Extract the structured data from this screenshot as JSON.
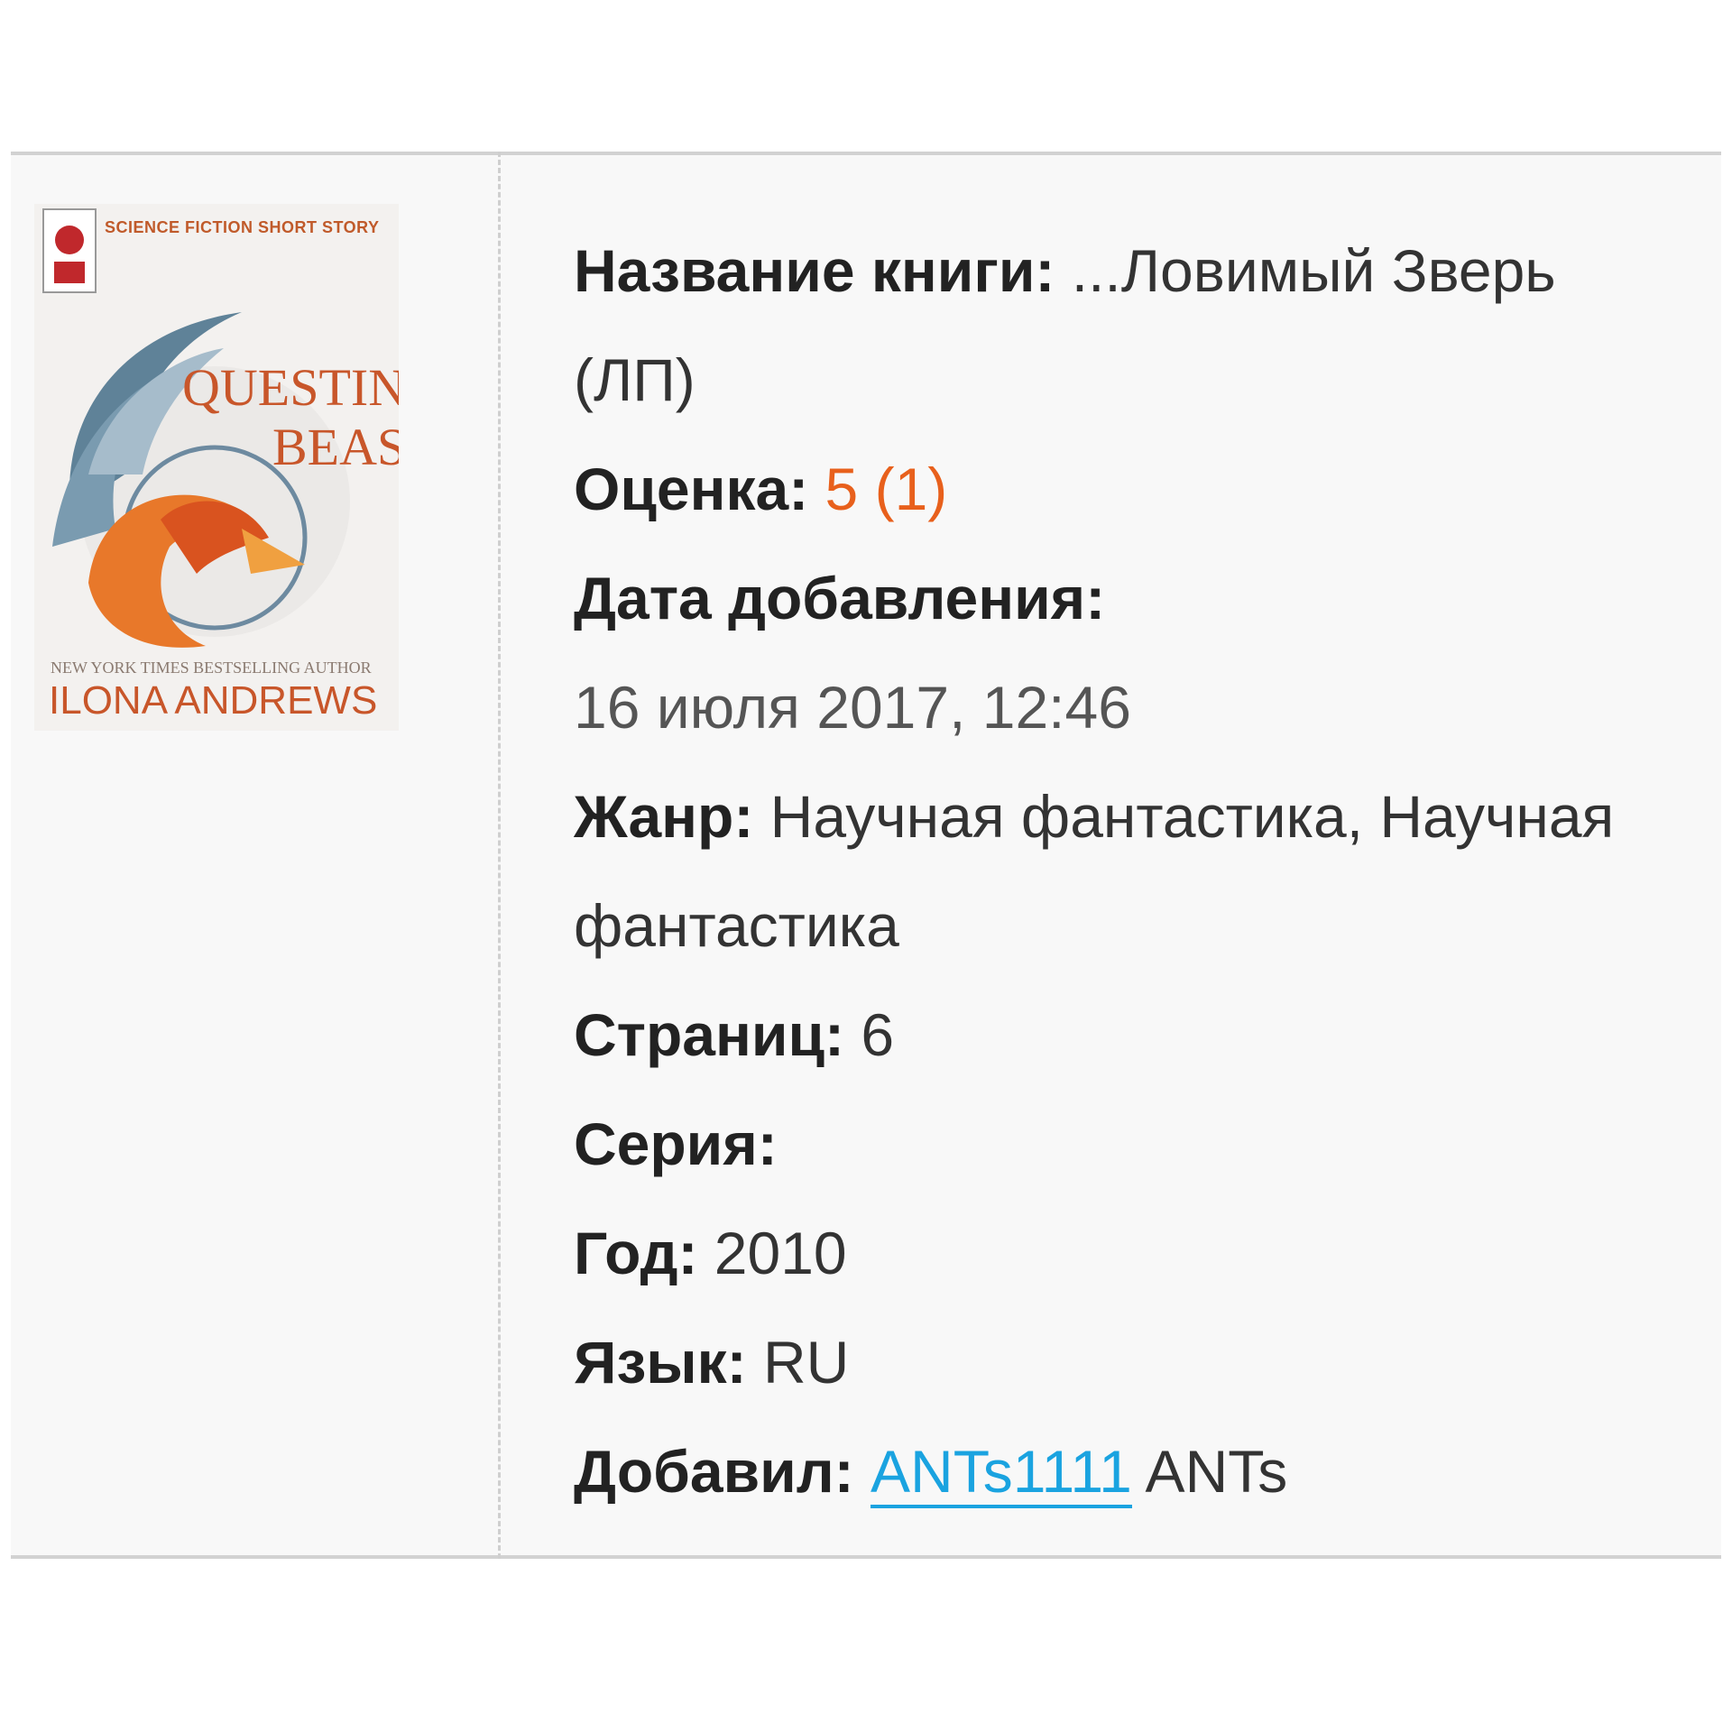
{
  "book": {
    "cover": {
      "tag": "SCIENCE FICTION SHORT STORY",
      "title_line1": "QUESTING",
      "title_line2": "BEAST",
      "subtitle": "NEW YORK TIMES BESTSELLING AUTHOR",
      "author": "ILONA ANDREWS"
    },
    "title_label": "Название книги:",
    "title_value": "...Ловимый Зверь (ЛП)",
    "rating_label": "Оценка:",
    "rating_value": "5 (1)",
    "date_label": "Дата добавления:",
    "date_value": "16 июля 2017, 12:46",
    "genre_label": "Жанр:",
    "genre_value": "Научная фантастика, Научная фантастика",
    "pages_label": "Страниц:",
    "pages_value": "6",
    "series_label": "Серия:",
    "series_value": "",
    "year_label": "Год:",
    "year_value": "2010",
    "language_label": "Язык:",
    "language_value": "RU",
    "added_by_label": "Добавил:",
    "added_by_link": "ANTs1111",
    "added_by_name": "ANTs"
  },
  "colors": {
    "rating": "#e8601c",
    "link": "#1aa3e0",
    "cover_accent": "#c8562a"
  }
}
